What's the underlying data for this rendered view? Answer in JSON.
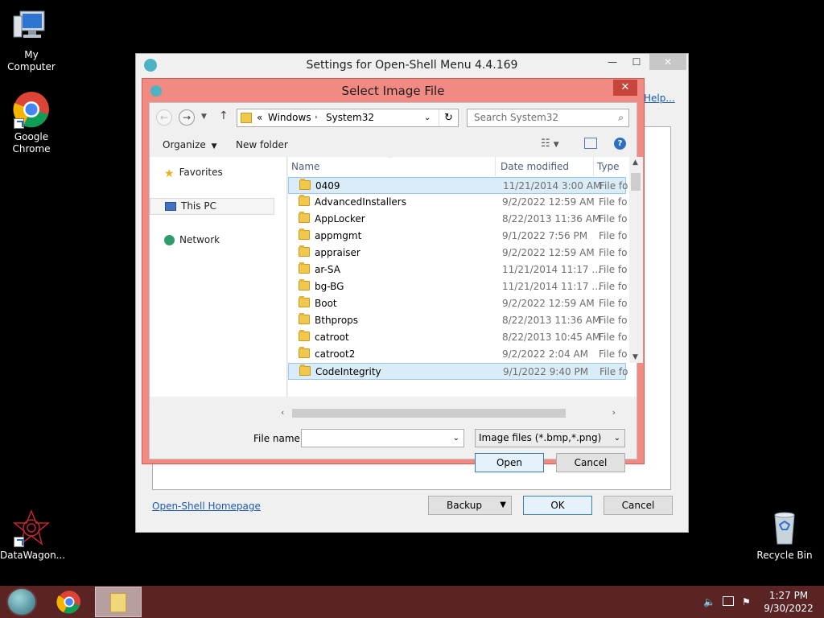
{
  "desktop": {
    "icons": [
      {
        "label": "My Computer",
        "icon": "computer-icon"
      },
      {
        "label": "Google Chrome",
        "icon": "chrome-icon"
      },
      {
        "label": "DataWagon...",
        "icon": "datawagon-icon"
      },
      {
        "label": "Recycle Bin",
        "icon": "recycle-bin-icon"
      }
    ]
  },
  "settings_window": {
    "title": "Settings for Open-Shell Menu 4.4.169",
    "help_link": "Help...",
    "homepage_link": "Open-Shell Homepage",
    "backup_label": "Backup",
    "ok_label": "OK",
    "cancel_label": "Cancel"
  },
  "dialog": {
    "title": "Select Image File",
    "close_glyph": "✕",
    "address": {
      "prefix": "«",
      "parts": [
        "Windows",
        "System32"
      ]
    },
    "search_placeholder": "Search System32",
    "toolbar": {
      "organize": "Organize",
      "new_folder": "New folder"
    },
    "nav": {
      "favorites": "Favorites",
      "this_pc": "This PC",
      "network": "Network"
    },
    "columns": {
      "name": "Name",
      "date": "Date modified",
      "type": "Type"
    },
    "rows": [
      {
        "name": "0409",
        "date": "11/21/2014 3:00 AM",
        "type": "File fol"
      },
      {
        "name": "AdvancedInstallers",
        "date": "9/2/2022 12:59 AM",
        "type": "File fol"
      },
      {
        "name": "AppLocker",
        "date": "8/22/2013 11:36 AM",
        "type": "File fol"
      },
      {
        "name": "appmgmt",
        "date": "9/1/2022 7:56 PM",
        "type": "File fol"
      },
      {
        "name": "appraiser",
        "date": "9/2/2022 12:59 AM",
        "type": "File fol"
      },
      {
        "name": "ar-SA",
        "date": "11/21/2014 11:17 ...",
        "type": "File fol"
      },
      {
        "name": "bg-BG",
        "date": "11/21/2014 11:17 ...",
        "type": "File fol"
      },
      {
        "name": "Boot",
        "date": "9/2/2022 12:59 AM",
        "type": "File fol"
      },
      {
        "name": "Bthprops",
        "date": "8/22/2013 11:36 AM",
        "type": "File fol"
      },
      {
        "name": "catroot",
        "date": "8/22/2013 10:45 AM",
        "type": "File fol"
      },
      {
        "name": "catroot2",
        "date": "9/2/2022 2:04 AM",
        "type": "File fol"
      },
      {
        "name": "CodeIntegrity",
        "date": "9/1/2022 9:40 PM",
        "type": "File fol"
      }
    ],
    "filename_label": "File name:",
    "filename_value": "",
    "filter": "Image files (*.bmp,*.png)",
    "open_label": "Open",
    "cancel_label": "Cancel"
  },
  "taskbar": {
    "time": "1:27 PM",
    "date": "9/30/2022"
  },
  "colors": {
    "dialog_frame": "#f08a82",
    "taskbar": "#5a2324",
    "selection": "#d9ecf8"
  }
}
